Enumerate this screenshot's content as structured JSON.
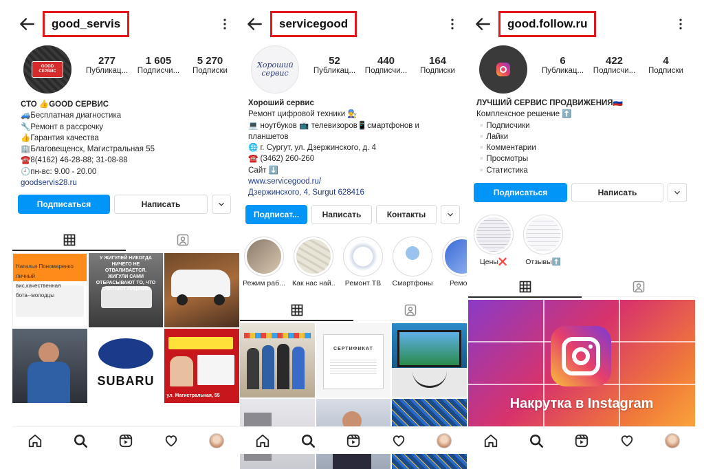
{
  "profiles": [
    {
      "username": "good_servis",
      "avatar_text": "GOOD СЕРВИС",
      "stats": [
        {
          "value": "277",
          "label": "Публикац..."
        },
        {
          "value": "1 605",
          "label": "Подписчи..."
        },
        {
          "value": "5 270",
          "label": "Подписки"
        }
      ],
      "bio": [
        "СТО 👍GOOD СЕРВИС",
        "🚙Бесплатная диагностика",
        "🔧Ремонт в рассрочку",
        "👍Гарантия качества",
        "🏢Благовещенск, Магистральная 55",
        "☎️8(4162) 46-28-88; 31-08-88",
        "🕘пн-вс: 9.00 - 20.00",
        "goodservis28.ru"
      ],
      "buttons": {
        "follow": "Подписаться",
        "message": "Написать"
      },
      "grid_texts": {
        "c1": "Наталья Пономаренко\nличный\nвис,качественная\nбота--молодцы",
        "c2": "У ЖИГУЛЕЙ НИКОГДА НИЧЕГО НЕ ОТВАЛИВАЕТСЯ.\nЖИГУЛИ САМИ ОТБРАСЫВАЮТ ТО, ЧТО СЧИТАЮТ ЛИШНИМ",
        "c5": "SUBARU",
        "c6": "ул. Магистральная, 55"
      }
    },
    {
      "username": "servicegood",
      "avatar_text": "Хороший сервис",
      "stats": [
        {
          "value": "52",
          "label": "Публикац..."
        },
        {
          "value": "440",
          "label": "Подписчи..."
        },
        {
          "value": "164",
          "label": "Подписки"
        }
      ],
      "bio": [
        "Хороший сервис",
        "Ремонт цифровой техники 👨‍🔧",
        "💻 ноутбуков 📺 телевизоров📱смартфонов и",
        "планшетов",
        "🌐 г. Сургут, ул. Дзержинского, д. 4",
        "☎️ (3462) 260-260",
        "Сайт ⬇️",
        "www.servicegood.ru/",
        "Дзержинского, 4, Surgut 628416"
      ],
      "buttons": {
        "follow": "Подписат...",
        "message": "Написать",
        "contacts": "Контакты"
      },
      "highlights": [
        "Режим раб...",
        "Как нас най...",
        "Ремонт ТВ",
        "Смартфоны",
        "Ремонт"
      ],
      "grid_texts": {
        "c2": "СЕРТИФИКАТ"
      }
    },
    {
      "username": "good.follow.ru",
      "stats": [
        {
          "value": "6",
          "label": "Публикац..."
        },
        {
          "value": "422",
          "label": "Подписчи..."
        },
        {
          "value": "4",
          "label": "Подписки"
        }
      ],
      "bio": [
        "ЛУЧШИЙ СЕРВИС ПРОДВИЖЕНИЯ🇷🇺",
        "Комплексное решение ⬆️",
        "▫️Подписчики",
        "▫️Лайки",
        "▫️Комментарии",
        "▫️Просмотры",
        "▫️Статистика"
      ],
      "buttons": {
        "follow": "Подписаться",
        "message": "Написать"
      },
      "highlights": [
        "Цены❌",
        "Отзывы⬆️"
      ],
      "banner_text": "Накрутка в Instagram"
    }
  ],
  "colors": {
    "accent": "#0095f6",
    "highlight_box": "#e2161b",
    "link": "#1e3a8a"
  },
  "icons": [
    "back-arrow-icon",
    "more-vertical-icon",
    "grid-icon",
    "tagged-icon",
    "home-icon",
    "search-icon",
    "reels-icon",
    "heart-icon",
    "chevron-down-icon"
  ]
}
